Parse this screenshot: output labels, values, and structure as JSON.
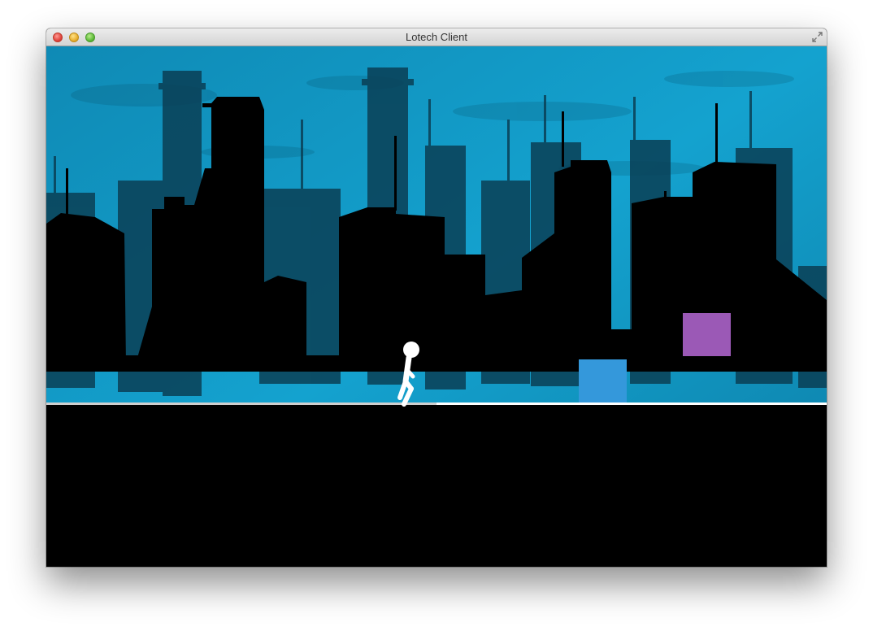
{
  "window": {
    "title": "Lotech Client",
    "controls": {
      "close": "close-icon",
      "minimize": "minimize-icon",
      "maximize": "maximize-icon",
      "fullscreen": "fullscreen-icon"
    }
  },
  "game": {
    "colors": {
      "sky": "#1399c4",
      "sky_dark": "#0b6f92",
      "city_far": "#0a3f55",
      "city_near": "#000000",
      "ground_line": "#ffffff",
      "player": "#ffffff",
      "box_blue": "#3498db",
      "box_purple": "#9b59b6"
    },
    "entities": [
      {
        "name": "player",
        "type": "stick-figure"
      },
      {
        "name": "blue-block",
        "type": "square"
      },
      {
        "name": "purple-block",
        "type": "square"
      }
    ]
  }
}
